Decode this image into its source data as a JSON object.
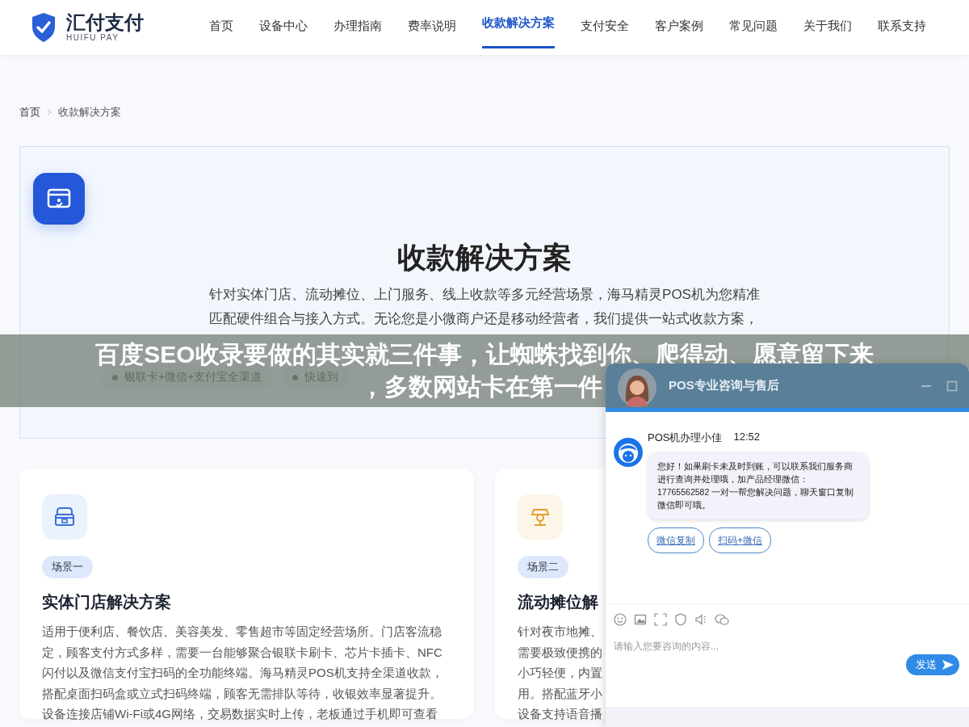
{
  "header": {
    "logo": {
      "name": "汇付支付",
      "subtitle": "HUIFU PAY"
    },
    "nav": [
      {
        "label": "首页",
        "selected": false
      },
      {
        "label": "设备中心",
        "selected": false
      },
      {
        "label": "办理指南",
        "selected": false
      },
      {
        "label": "费率说明",
        "selected": false
      },
      {
        "label": "收款解决方案",
        "selected": true
      },
      {
        "label": "支付安全",
        "selected": false
      },
      {
        "label": "客户案例",
        "selected": false
      },
      {
        "label": "常见问题",
        "selected": false
      },
      {
        "label": "关于我们",
        "selected": false
      },
      {
        "label": "联系支持",
        "selected": false
      }
    ]
  },
  "breadcrumb": [
    "首页",
    "收款解决方案"
  ],
  "hero": {
    "title": "收款解决方案",
    "description": [
      "针对实体门店、流动摊位、上门服务、线上收款等多元经营场景，海马精灵POS机为您精准",
      "匹配硬件组合与接入方式。无论您是小微商户还是移动经营者，我们提供一站式收款方案，"
    ],
    "features": [
      "银联卡+微信+支付宝全渠道",
      "快速到"
    ]
  },
  "scenarios": [
    {
      "tag": "场景一",
      "title": "实体门店解决方案",
      "lines": [
        "适用于便利店、餐饮店、美容美发、零售超市等固定经营场所。门店客流稳",
        "定，顾客支付方式多样，需要一台能够聚合银联卡刷卡、芯片卡插卡、NFC",
        "闪付以及微信支付宝扫码的全功能终端。海马精灵POS机支持全渠道收款，",
        "搭配桌面扫码盒或立式扫码终端，顾客无需排队等待，收银效率显著提升。",
        "设备连接店铺Wi-Fi或4G网络，交易数据实时上传，老板通过手机即可查看"
      ]
    },
    {
      "tag": "场景二",
      "title": "流动摊位解",
      "lines": [
        "针对夜市地摊、",
        "需要极致便携的",
        "小巧轻便，内置",
        "用。搭配蓝牙小",
        "设备支持语音播"
      ]
    }
  ],
  "chat": {
    "title": "POS专业咨询与售后",
    "agent": "POS机办理小佳",
    "time": "12:52",
    "message": "您好！如果刷卡未及时到账，可以联系我们服务商进行查询并处理哦，加产品经理微信：17765562582 一对一帮您解决问题，聊天窗口复制微信即可哦。",
    "actions": [
      "微信复制",
      "扫码+微信"
    ],
    "input": {
      "placeholder": "请输入您要咨询的内容..."
    },
    "send": "发送"
  },
  "banner": {
    "lines": [
      "百度SEO收录要做的其实就三件事，让蜘蛛找到你、爬得动、愿意留下来",
      "，多数网站卡在第一件"
    ]
  }
}
